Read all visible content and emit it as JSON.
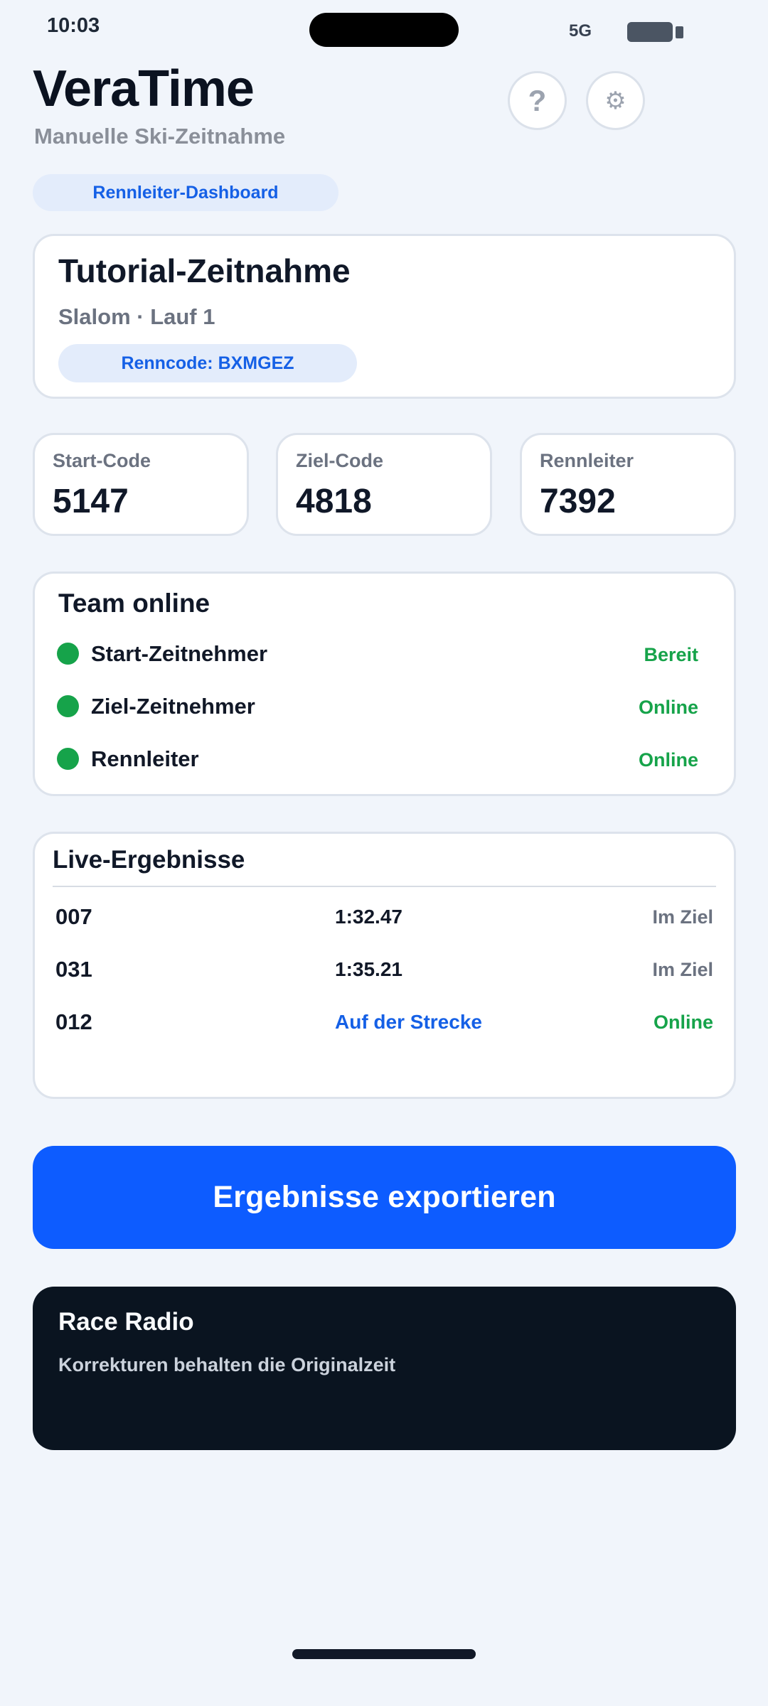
{
  "status_bar": {
    "time": "10:03",
    "network": "5G"
  },
  "header": {
    "title": "VeraTime",
    "subtitle": "Manuelle Ski-Zeitnahme",
    "help_icon": "?",
    "settings_icon": "⚙",
    "role_label": "Rennleiter-Dashboard"
  },
  "race": {
    "name": "Tutorial-Zeitnahme",
    "subtitle": "Slalom · Lauf 1",
    "code_label": "Renncode: BXMGEZ"
  },
  "codes": [
    {
      "label": "Start-Code",
      "value": "5147"
    },
    {
      "label": "Ziel-Code",
      "value": "4818"
    },
    {
      "label": "Rennleiter",
      "value": "7392"
    }
  ],
  "team": {
    "title": "Team online",
    "members": [
      {
        "name": "Start-Zeitnehmer",
        "status": "Bereit"
      },
      {
        "name": "Ziel-Zeitnehmer",
        "status": "Online"
      },
      {
        "name": "Rennleiter",
        "status": "Online"
      }
    ]
  },
  "results": {
    "title": "Live-Ergebnisse",
    "rows": [
      {
        "bib": "007",
        "time": "1:32.47",
        "status": "Im Ziel"
      },
      {
        "bib": "031",
        "time": "1:35.21",
        "status": "Im Ziel"
      },
      {
        "bib": "012",
        "time": "Auf der Strecke",
        "status": "Online"
      }
    ]
  },
  "export_label": "Ergebnisse exportieren",
  "radio": {
    "title": "Race Radio",
    "message": "Korrekturen behalten die Originalzeit"
  },
  "colors": {
    "accent": "#0d5cff",
    "online": "#16a34a",
    "background": "#f1f5fb",
    "radio_bg": "#0a1420"
  }
}
